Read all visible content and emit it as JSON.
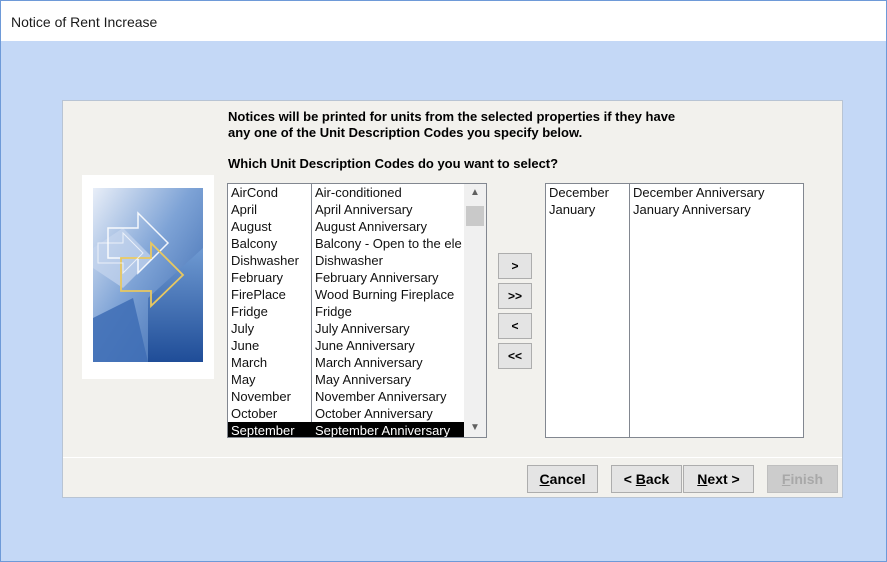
{
  "window": {
    "title": "Notice of Rent Increase"
  },
  "wizard": {
    "intro_line1": "Notices will be printed for units from the selected properties if they have",
    "intro_line2": "any one of the Unit Description Codes you specify below.",
    "question": "Which Unit Description Codes do you want to select?"
  },
  "available_codes": [
    {
      "code": "AirCond",
      "description": "Air-conditioned"
    },
    {
      "code": "April",
      "description": "April Anniversary"
    },
    {
      "code": "August",
      "description": "August Anniversary"
    },
    {
      "code": "Balcony",
      "description": "Balcony - Open to the ele"
    },
    {
      "code": "Dishwasher",
      "description": "Dishwasher"
    },
    {
      "code": "February",
      "description": "February Anniversary"
    },
    {
      "code": "FirePlace",
      "description": "Wood Burning Fireplace"
    },
    {
      "code": "Fridge",
      "description": "Fridge"
    },
    {
      "code": "July",
      "description": "July Anniversary"
    },
    {
      "code": "June",
      "description": "June Anniversary"
    },
    {
      "code": "March",
      "description": "March Anniversary"
    },
    {
      "code": "May",
      "description": "May Anniversary"
    },
    {
      "code": "November",
      "description": "November Anniversary"
    },
    {
      "code": "October",
      "description": "October Anniversary"
    },
    {
      "code": "September",
      "description": "September Anniversary",
      "selected": true
    }
  ],
  "selected_codes": [
    {
      "code": "December",
      "description": "December Anniversary"
    },
    {
      "code": "January",
      "description": "January Anniversary"
    }
  ],
  "move_buttons": {
    "add_one": ">",
    "add_all": ">>",
    "remove_one": "<",
    "remove_all": "<<"
  },
  "nav": {
    "cancel_hotkey": "C",
    "cancel_rest": "ancel",
    "back_prefix": "< ",
    "back_hotkey": "B",
    "back_rest": "ack",
    "next_hotkey": "N",
    "next_rest": "ext >",
    "finish_hotkey": "F",
    "finish_rest": "inish"
  },
  "icons": {
    "scroll_up": "chevron-up-icon",
    "scroll_down": "chevron-down-icon",
    "artwork": "wizard-banner-arrows-icon"
  },
  "colors": {
    "background": "#c4d8f6",
    "panel": "#f2f1ed",
    "selection": "#000000",
    "button": "#e4e4e4",
    "disabled_text": "#a8a8a8"
  }
}
